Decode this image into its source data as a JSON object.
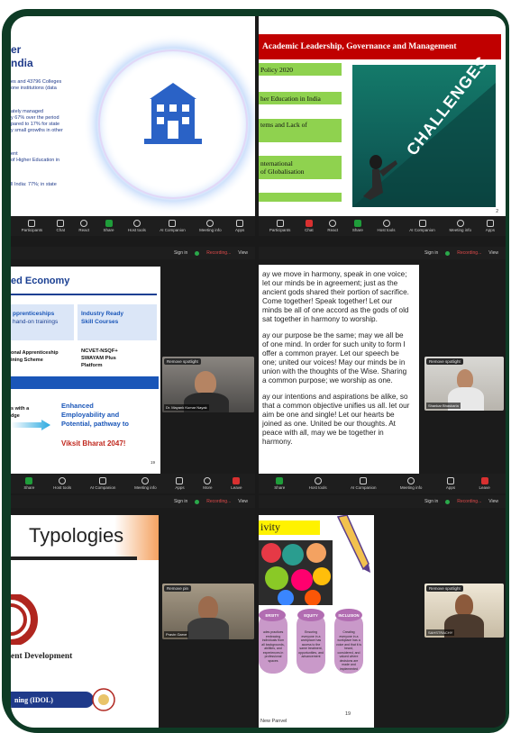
{
  "tile1": {
    "title_line1": "er",
    "title_line2": "ndia",
    "text1a": "es and 43796 Colleges",
    "text1b": "one institutions (data",
    "text2a": "ately managed",
    "text2b": "y 67% over the period",
    "text2c": "pared to 17% for state",
    "text2d": "y small growths in other",
    "text3a": "ent",
    "text3b": "of Higher Education in",
    "text4": "ll India: 77%; in state",
    "icon": "university-building-icon"
  },
  "tile2": {
    "header": "Academic Leadership, Governance and Management",
    "box1": "Policy 2020",
    "box2": "her Education in India",
    "box3": "tems and Lack of",
    "box4a": "nternational",
    "box4b": "of Globalisation",
    "challenge_word": "CHALLENGES",
    "page_num": "2"
  },
  "toolbar_top": {
    "participants": "Participants",
    "participants_count": "33",
    "chat": "Chat",
    "react": "React",
    "share": "Share",
    "host_tools": "Host tools",
    "ai": "AI Companion",
    "meeting_info": "Meeting info",
    "apps": "Apps"
  },
  "toolbar_top2": {
    "participants": "Participants",
    "participants_count": "31",
    "chat": "Chat",
    "react": "React",
    "share": "Share",
    "host_tools": "Host tools",
    "ai": "AI Companion",
    "meeting_info": "Meeting info",
    "apps": "Apps"
  },
  "topbar": {
    "sign_in": "Sign in",
    "recording": "Recording...",
    "view": "View"
  },
  "tile3": {
    "title": "ed Economy",
    "box_left_1": "pprenticeships",
    "box_left_2": "hand-on trainings",
    "box_right_1": "Industry Ready",
    "box_right_2": "Skill Courses",
    "row2_left_1": "onal Apprenticeship",
    "row2_left_2": "ining Scheme",
    "row2_right_1": "NCVET-NSQF+",
    "row2_right_2": "SWAYAM Plus",
    "row2_right_3": "Platform",
    "arrow_left_1": "s with a",
    "arrow_left_2": "dge",
    "enh1": "Enhanced",
    "enh2": "Employability and",
    "enh3": "Potential, pathway to",
    "viksit": "Viksit Bharat 2047!",
    "page_num": "19",
    "spotlight": "Remove spotlight",
    "video_name": "Dr. Mayank Kumar Nayak"
  },
  "tile4": {
    "p1": "ay we move in harmony, speak in one voice; let our minds be in agreement; just as the ancient gods shared their portion of sacrifice. Come together! Speak together! Let our minds be all of one accord as the gods of old sat together in harmony to worship.",
    "p2": "ay our purpose be the same; may we all be of one mind. In order for such unity to form I offer a common prayer. Let our speech be one; united our voices! May our minds be in union with the thoughts of the Wise. Sharing a common purpose; we worship as one.",
    "p3": "ay our intentions and aspirations be alike, so that a common objective unifies us all. let our aim be one and single! Let our hearts be joined as one. United be our thoughts. At peace with all, may we be together in harmony.",
    "spotlight": "Remove spotlight",
    "video_name": "Shankar Bhaskarla"
  },
  "toolbar_mid": {
    "share": "Share",
    "host_tools": "Host tools",
    "ai": "AI Companion",
    "meeting_info": "Meeting info",
    "apps": "Apps",
    "more": "More",
    "leave": "Leave"
  },
  "tile5": {
    "title": "Typologies",
    "logo_text": "ent Development",
    "footer_text": "ning (IDOL)",
    "remove_pin": "Remove pin",
    "video_name": "Pravin Garve"
  },
  "tile6": {
    "title": "ivity",
    "pill1": "ERSITY",
    "pill2": "EQUITY",
    "pill3": "INCLUSION",
    "pill1_text": "udes practices embracing individuals from all backgrounds, abilities, and experiences in professional spaces",
    "pill2_text": "Ensuring everyone in a workplace has access to the same treatment, opportunities, and advancement",
    "pill3_text": "Creating everyone in a workplace has a voice and that it is heard, considered, and valued where decisions are made and implemented",
    "footer": "New Panvel",
    "page_num": "19",
    "spotlight": "Remove spotlight",
    "video_name": "SAHSTRACHY"
  },
  "colors": {
    "border": "#0e3b25",
    "header_red": "#c00000",
    "box_green": "#8fd24f",
    "accent_blue": "#1a56b8"
  }
}
